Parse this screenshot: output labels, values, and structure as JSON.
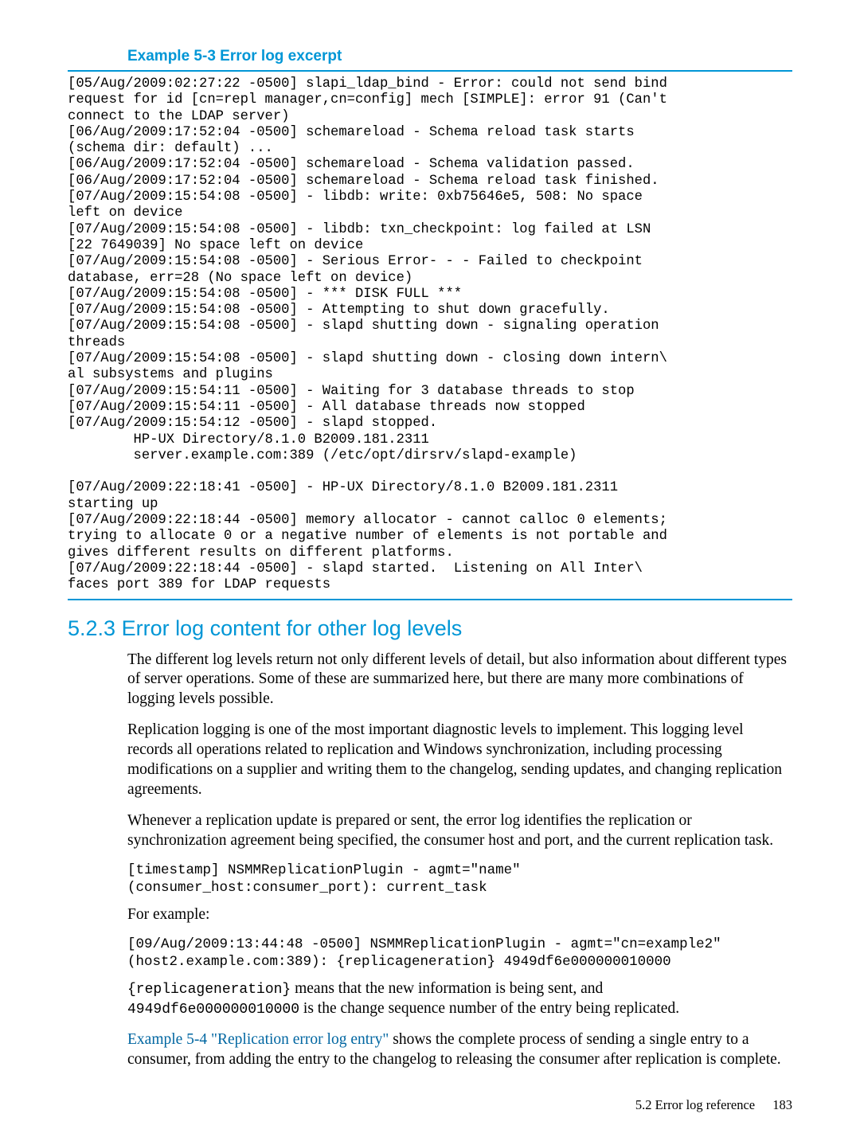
{
  "example_title": "Example 5-3 Error log excerpt",
  "log_block": "[05/Aug/2009:02:27:22 -0500] slapi_ldap_bind - Error: could not send bind\nrequest for id [cn=repl manager,cn=config] mech [SIMPLE]: error 91 (Can't\nconnect to the LDAP server)\n[06/Aug/2009:17:52:04 -0500] schemareload - Schema reload task starts\n(schema dir: default) ...\n[06/Aug/2009:17:52:04 -0500] schemareload - Schema validation passed.\n[06/Aug/2009:17:52:04 -0500] schemareload - Schema reload task finished.\n[07/Aug/2009:15:54:08 -0500] - libdb: write: 0xb75646e5, 508: No space\nleft on device\n[07/Aug/2009:15:54:08 -0500] - libdb: txn_checkpoint: log failed at LSN\n[22 7649039] No space left on device\n[07/Aug/2009:15:54:08 -0500] - Serious Error- - - Failed to checkpoint\ndatabase, err=28 (No space left on device)\n[07/Aug/2009:15:54:08 -0500] - *** DISK FULL ***\n[07/Aug/2009:15:54:08 -0500] - Attempting to shut down gracefully.\n[07/Aug/2009:15:54:08 -0500] - slapd shutting down - signaling operation\nthreads\n[07/Aug/2009:15:54:08 -0500] - slapd shutting down - closing down intern\\\nal subsystems and plugins\n[07/Aug/2009:15:54:11 -0500] - Waiting for 3 database threads to stop\n[07/Aug/2009:15:54:11 -0500] - All database threads now stopped\n[07/Aug/2009:15:54:12 -0500] - slapd stopped.\n        HP-UX Directory/8.1.0 B2009.181.2311\n        server.example.com:389 (/etc/opt/dirsrv/slapd-example)\n\n[07/Aug/2009:22:18:41 -0500] - HP-UX Directory/8.1.0 B2009.181.2311\nstarting up\n[07/Aug/2009:22:18:44 -0500] memory allocator - cannot calloc 0 elements;\ntrying to allocate 0 or a negative number of elements is not portable and\ngives different results on different platforms.\n[07/Aug/2009:22:18:44 -0500] - slapd started.  Listening on All Inter\\\nfaces port 389 for LDAP requests",
  "section": {
    "number": "5.2.3",
    "title": "Error log content for other log levels"
  },
  "paragraphs": {
    "p1": "The different log levels return not only different levels of detail, but also information about different types of server operations. Some of these are summarized here, but there are many more combinations of logging levels possible.",
    "p2": "Replication logging is one of the most important diagnostic levels to implement. This logging level records all operations related to replication and Windows synchronization, including processing modifications on a supplier and writing them to the changelog, sending updates, and changing replication agreements.",
    "p3": "Whenever a replication update is prepared or sent, the error log identifies the replication or synchronization agreement being specified, the consumer host and port, and the current replication task.",
    "code1": "[timestamp] NSMMReplicationPlugin - agmt=\"name\"\n(consumer_host:consumer_port): current_task",
    "p4": "For example:",
    "code2": "[09/Aug/2009:13:44:48 -0500] NSMMReplicationPlugin - agmt=\"cn=example2\"\n(host2.example.com:389): {replicageneration} 4949df6e000000010000",
    "p5_code_a": "{replicageneration}",
    "p5_text_a": " means that the new information is being sent, and ",
    "p5_code_b": "4949df6e000000010000",
    "p5_text_b": " is the change sequence number of the entry being replicated.",
    "p6_link": "Example 5-4 \"Replication error log entry\"",
    "p6_rest": " shows the complete process of sending a single entry to a consumer, from adding the entry to the changelog to releasing the consumer after replication is complete."
  },
  "footer": {
    "section_ref": "5.2 Error log reference",
    "page_num": "183"
  }
}
